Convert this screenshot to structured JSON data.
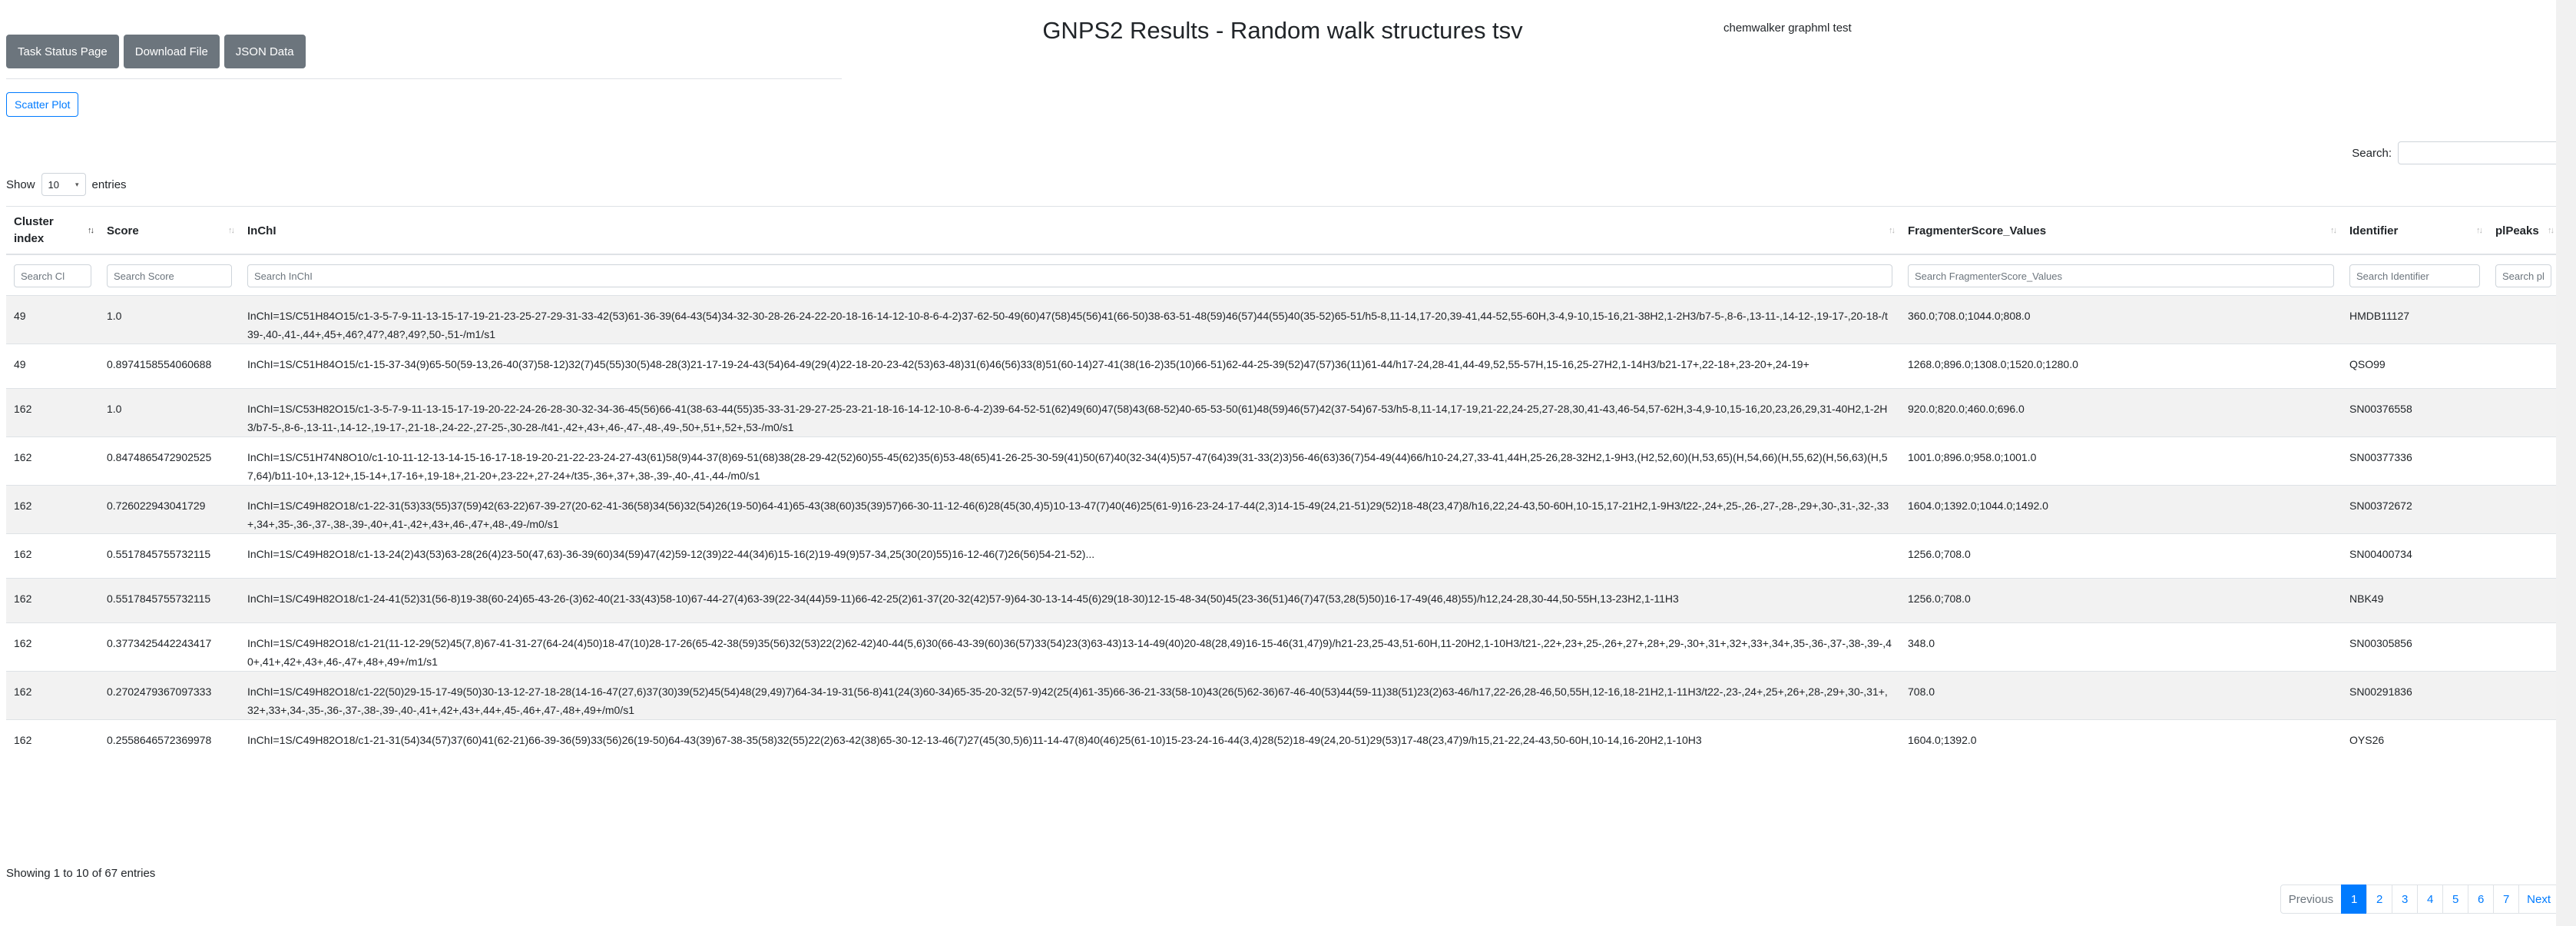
{
  "toolbar": {
    "task_status": "Task Status Page",
    "download": "Download File",
    "json": "JSON Data",
    "scatter": "Scatter Plot"
  },
  "page": {
    "title": "GNPS2 Results - Random walk structures tsv",
    "subtitle": "chemwalker graphml test"
  },
  "length": {
    "show": "Show",
    "value": "10",
    "entries": "entries"
  },
  "search": {
    "label": "Search:",
    "value": ""
  },
  "columns": [
    {
      "label": "Cluster index",
      "filter": "Search Cl"
    },
    {
      "label": "Score",
      "filter": "Search Score"
    },
    {
      "label": "InChI",
      "filter": "Search InChI"
    },
    {
      "label": "FragmenterScore_Values",
      "filter": "Search FragmenterScore_Values"
    },
    {
      "label": "Identifier",
      "filter": "Search Identifier"
    },
    {
      "label": "plPeaks",
      "filter": "Search pl"
    }
  ],
  "rows": [
    {
      "cluster": "49",
      "score": "1.0",
      "inchi": "InChI=1S/C51H84O15/c1-3-5-7-9-11-13-15-17-19-21-23-25-27-29-31-33-42(53)61-36-39(64-43(54)34-32-30-28-26-24-22-20-18-16-14-12-10-8-6-4-2)37-62-50-49(60)47(58)45(56)41(66-50)38-63-51-48(59)46(57)44(55)40(35-52)65-51/h5-8,11-14,17-20,39-41,44-52,55-60H,3-4,9-10,15-16,21-38H2,1-2H3/b7-5-,8-6-,13-11-,14-12-,19-17-,20-18-/t39-,40-,41-,44+,45+,46?,47?,48?,49?,50-,51-/m1/s1",
      "frag": "360.0;708.0;1044.0;808.0",
      "id": "HMDB11127",
      "peaks": ""
    },
    {
      "cluster": "49",
      "score": "0.8974158554060688",
      "inchi": "InChI=1S/C51H84O15/c1-15-37-34(9)65-50(59-13,26-40(37)58-12)32(7)45(55)30(5)48-28(3)21-17-19-24-43(54)64-49(29(4)22-18-20-23-42(53)63-48)31(6)46(56)33(8)51(60-14)27-41(38(16-2)35(10)66-51)62-44-25-39(52)47(57)36(11)61-44/h17-24,28-41,44-49,52,55-57H,15-16,25-27H2,1-14H3/b21-17+,22-18+,23-20+,24-19+",
      "frag": "1268.0;896.0;1308.0;1520.0;1280.0",
      "id": "QSO99",
      "peaks": ""
    },
    {
      "cluster": "162",
      "score": "1.0",
      "inchi": "InChI=1S/C53H82O15/c1-3-5-7-9-11-13-15-17-19-20-22-24-26-28-30-32-34-36-45(56)66-41(38-63-44(55)35-33-31-29-27-25-23-21-18-16-14-12-10-8-6-4-2)39-64-52-51(62)49(60)47(58)43(68-52)40-65-53-50(61)48(59)46(57)42(37-54)67-53/h5-8,11-14,17-19,21-22,24-25,27-28,30,41-43,46-54,57-62H,3-4,9-10,15-16,20,23,26,29,31-40H2,1-2H3/b7-5-,8-6-,13-11-,14-12-,19-17-,21-18-,24-22-,27-25-,30-28-/t41-,42+,43+,46-,47-,48-,49-,50+,51+,52+,53-/m0/s1",
      "frag": "920.0;820.0;460.0;696.0",
      "id": "SN00376558",
      "peaks": ""
    },
    {
      "cluster": "162",
      "score": "0.8474865472902525",
      "inchi": "InChI=1S/C51H74N8O10/c1-10-11-12-13-14-15-16-17-18-19-20-21-22-23-24-27-43(61)58(9)44-37(8)69-51(68)38(28-29-42(52)60)55-45(62)35(6)53-48(65)41-26-25-30-59(41)50(67)40(32-34(4)5)57-47(64)39(31-33(2)3)56-46(63)36(7)54-49(44)66/h10-24,27,33-41,44H,25-26,28-32H2,1-9H3,(H2,52,60)(H,53,65)(H,54,66)(H,55,62)(H,56,63)(H,57,64)/b11-10+,13-12+,15-14+,17-16+,19-18+,21-20+,23-22+,27-24+/t35-,36+,37+,38-,39-,40-,41-,44-/m0/s1",
      "frag": "1001.0;896.0;958.0;1001.0",
      "id": "SN00377336",
      "peaks": ""
    },
    {
      "cluster": "162",
      "score": "0.726022943041729",
      "inchi": "InChI=1S/C49H82O18/c1-22-31(53)33(55)37(59)42(63-22)67-39-27(20-62-41-36(58)34(56)32(54)26(19-50)64-41)65-43(38(60)35(39)57)66-30-11-12-46(6)28(45(30,4)5)10-13-47(7)40(46)25(61-9)16-23-24-17-44(2,3)14-15-49(24,21-51)29(52)18-48(23,47)8/h16,22,24-43,50-60H,10-15,17-21H2,1-9H3/t22-,24+,25-,26-,27-,28-,29+,30-,31-,32-,33+,34+,35-,36-,37-,38-,39-,40+,41-,42+,43+,46-,47+,48-,49-/m0/s1",
      "frag": "1604.0;1392.0;1044.0;1492.0",
      "id": "SN00372672",
      "peaks": ""
    },
    {
      "cluster": "162",
      "score": "0.5517845755732115",
      "inchi": "InChI=1S/C49H82O18/c1-13-24(2)43(53)63-28(26(4)23-50(47,63)-36-39(60)34(59)47(42)59-12(39)22-44(34)6)15-16(2)19-49(9)57-34,25(30(20)55)16-12-46(7)26(56)54-21-52)...",
      "frag": "1256.0;708.0",
      "id": "SN00400734",
      "peaks": ""
    },
    {
      "cluster": "162",
      "score": "0.5517845755732115",
      "inchi": "InChI=1S/C49H82O18/c1-24-41(52)31(56-8)19-38(60-24)65-43-26-(3)62-40(21-33(43)58-10)67-44-27(4)63-39(22-34(44)59-11)66-42-25(2)61-37(20-32(42)57-9)64-30-13-14-45(6)29(18-30)12-15-48-34(50)45(23-36(51)46(7)47(53,28(5)50)16-17-49(46,48)55)/h12,24-28,30-44,50-55H,13-23H2,1-11H3",
      "frag": "1256.0;708.0",
      "id": "NBK49",
      "peaks": ""
    },
    {
      "cluster": "162",
      "score": "0.3773425442243417",
      "inchi": "InChI=1S/C49H82O18/c1-21(11-12-29(52)45(7,8)67-41-31-27(64-24(4)50)18-47(10)28-17-26(65-42-38(59)35(56)32(53)22(2)62-42)40-44(5,6)30(66-43-39(60)36(57)33(54)23(3)63-43)13-14-49(40)20-48(28,49)16-15-46(31,47)9)/h21-23,25-43,51-60H,11-20H2,1-10H3/t21-,22+,23+,25-,26+,27+,28+,29-,30+,31+,32+,33+,34+,35-,36-,37-,38-,39-,40+,41+,42+,43+,46-,47+,48+,49+/m1/s1",
      "frag": "348.0",
      "id": "SN00305856",
      "peaks": ""
    },
    {
      "cluster": "162",
      "score": "0.2702479367097333",
      "inchi": "InChI=1S/C49H82O18/c1-22(50)29-15-17-49(50)30-13-12-27-18-28(14-16-47(27,6)37(30)39(52)45(54)48(29,49)7)64-34-19-31(56-8)41(24(3)60-34)65-35-20-32(57-9)42(25(4)61-35)66-36-21-33(58-10)43(26(5)62-36)67-46-40(53)44(59-11)38(51)23(2)63-46/h17,22-26,28-46,50,55H,12-16,18-21H2,1-11H3/t22-,23-,24+,25+,26+,28-,29+,30-,31+,32+,33+,34-,35-,36-,37-,38-,39-,40-,41+,42+,43+,44+,45-,46+,47-,48+,49+/m0/s1",
      "frag": "708.0",
      "id": "SN00291836",
      "peaks": ""
    },
    {
      "cluster": "162",
      "score": "0.2558646572369978",
      "inchi": "InChI=1S/C49H82O18/c1-21-31(54)34(57)37(60)41(62-21)66-39-36(59)33(56)26(19-50)64-43(39)67-38-35(58)32(55)22(2)63-42(38)65-30-12-13-46(7)27(45(30,5)6)11-14-47(8)40(46)25(61-10)15-23-24-16-44(3,4)28(52)18-49(24,20-51)29(53)17-48(23,47)9/h15,21-22,24-43,50-60H,10-14,16-20H2,1-10H3",
      "frag": "1604.0;1392.0",
      "id": "OYS26",
      "peaks": ""
    }
  ],
  "info": "Showing 1 to 10 of 67 entries",
  "pager": {
    "prev": "Previous",
    "pages": [
      "1",
      "2",
      "3",
      "4",
      "5",
      "6",
      "7"
    ],
    "next": "Next"
  }
}
